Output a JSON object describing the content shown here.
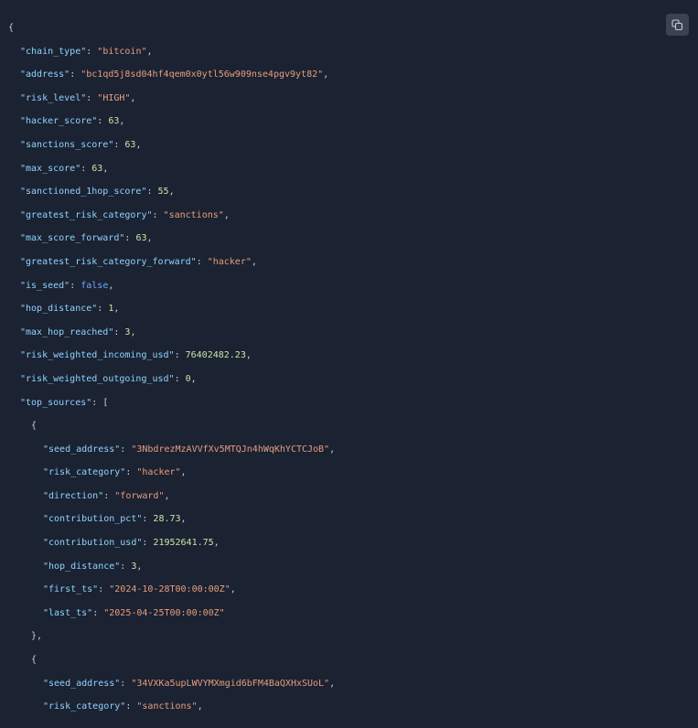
{
  "colors": {
    "background": "#1b2232",
    "key": "#8fd3ff",
    "string": "#e79e7c",
    "number": "#c9e6a6",
    "boolean": "#6fa6ff",
    "punctuation": "#c9d1d9"
  },
  "copy_button": {
    "icon": "copy-icon"
  },
  "code": {
    "chain_type": {
      "key": "\"chain_type\"",
      "value": "\"bitcoin\""
    },
    "address": {
      "key": "\"address\"",
      "value": "\"bc1qd5j8sd04hf4qem0x0ytl56w909nse4pgv9yt82\""
    },
    "risk_level": {
      "key": "\"risk_level\"",
      "value": "\"HIGH\""
    },
    "hacker_score": {
      "key": "\"hacker_score\"",
      "value": "63"
    },
    "sanctions_score": {
      "key": "\"sanctions_score\"",
      "value": "63"
    },
    "max_score": {
      "key": "\"max_score\"",
      "value": "63"
    },
    "sanctioned_1hop_score": {
      "key": "\"sanctioned_1hop_score\"",
      "value": "55"
    },
    "greatest_risk_category": {
      "key": "\"greatest_risk_category\"",
      "value": "\"sanctions\""
    },
    "max_score_forward": {
      "key": "\"max_score_forward\"",
      "value": "63"
    },
    "greatest_risk_category_forward": {
      "key": "\"greatest_risk_category_forward\"",
      "value": "\"hacker\""
    },
    "is_seed": {
      "key": "\"is_seed\"",
      "value": "false"
    },
    "hop_distance": {
      "key": "\"hop_distance\"",
      "value": "1"
    },
    "max_hop_reached": {
      "key": "\"max_hop_reached\"",
      "value": "3"
    },
    "risk_weighted_incoming_usd": {
      "key": "\"risk_weighted_incoming_usd\"",
      "value": "76402482.23"
    },
    "risk_weighted_outgoing_usd": {
      "key": "\"risk_weighted_outgoing_usd\"",
      "value": "0"
    },
    "top_sources_key": "\"top_sources\"",
    "top_sources": [
      {
        "seed_address": {
          "key": "\"seed_address\"",
          "value": "\"3NbdrezMzAVVfXv5MTQJn4hWqKhYCTCJoB\""
        },
        "risk_category": {
          "key": "\"risk_category\"",
          "value": "\"hacker\""
        },
        "direction": {
          "key": "\"direction\"",
          "value": "\"forward\""
        },
        "contribution_pct": {
          "key": "\"contribution_pct\"",
          "value": "28.73"
        },
        "contribution_usd": {
          "key": "\"contribution_usd\"",
          "value": "21952641.75"
        },
        "hop_distance": {
          "key": "\"hop_distance\"",
          "value": "3"
        },
        "first_ts": {
          "key": "\"first_ts\"",
          "value": "\"2024-10-28T00:00:00Z\""
        },
        "last_ts": {
          "key": "\"last_ts\"",
          "value": "\"2025-04-25T00:00:00Z\""
        }
      },
      {
        "seed_address": {
          "key": "\"seed_address\"",
          "value": "\"34VXKa5upLWVYMXmgid6bFM4BaQXHxSUoL\""
        },
        "risk_category": {
          "key": "\"risk_category\"",
          "value": "\"sanctions\""
        }
      }
    ]
  }
}
